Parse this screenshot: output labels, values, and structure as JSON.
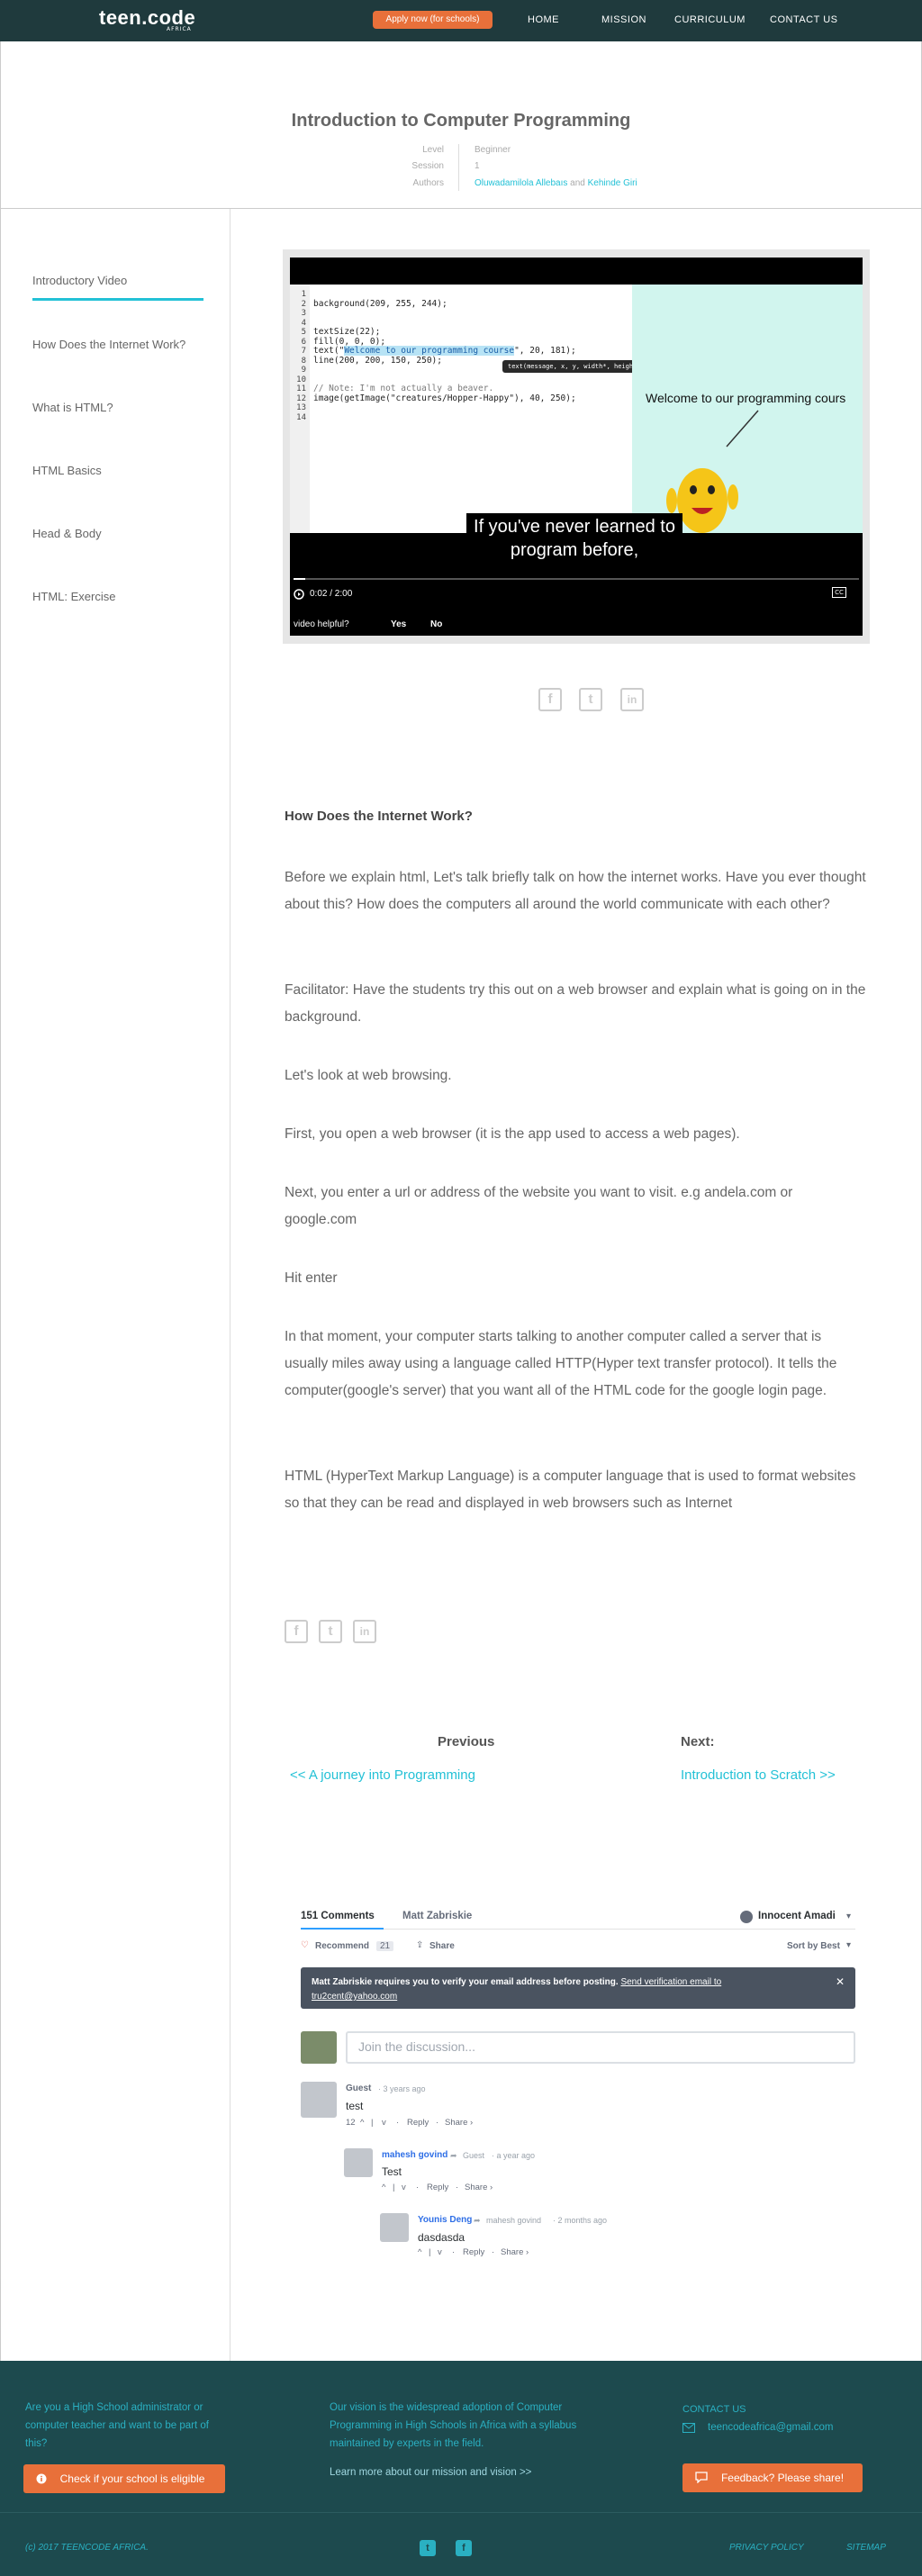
{
  "nav": {
    "logo": "teen.code",
    "logo_sub": "AFRICA",
    "apply_label": "Apply now (for schools)",
    "links": [
      "HOME",
      "MISSION",
      "CURRICULUM",
      "CONTACT US"
    ]
  },
  "header": {
    "title": "Introduction to Computer Programming",
    "level_label": "Level",
    "level_value": "Beginner",
    "session_label": "Session",
    "session_value": "1",
    "authors_label": "Authors",
    "author_1": "Oluwadamilola Allebaıs",
    "author_join": "and",
    "author_2": "Kehinde Giri"
  },
  "sidebar": {
    "items": [
      {
        "label": "Introductory Video"
      },
      {
        "label": "How Does the Internet Work?"
      },
      {
        "label": "What is HTML?"
      },
      {
        "label": "HTML Basics"
      },
      {
        "label": "Head & Body"
      },
      {
        "label": "HTML: Exercise"
      }
    ]
  },
  "video": {
    "line_numbers": "1\n2\n3\n4\n5\n6\n7\n8\n9\n10\n11\n12\n13\n14",
    "code_l2": "background(209, 255, 244);",
    "code_l5": "textSize(22);",
    "code_l6": "fill(0, 0, 0);",
    "code_l7_pre": "text(\"",
    "code_l7_hl": "Welcome to our programming course",
    "code_l7_post": "\", 20, 181);",
    "code_l8": "line(200, 200, 150, 250);",
    "code_l11": "// Note: I'm not actually a beaver.",
    "code_l12": "image(getImage(\"creatures/Hopper-Happy\"), 40, 250);",
    "tooltip": "text(message, x, y, width*, height*)",
    "canvas_text": "Welcome to our programming cours",
    "caption": "If you've never learned to program before,",
    "time": "0:02 / 2:00",
    "progress": 0.02,
    "cc": "CC",
    "helpful_label": "video helpful?",
    "yes": "Yes",
    "no": "No"
  },
  "article": {
    "heading": "How Does the Internet Work?",
    "paragraphs": [
      "Before we explain html, Let's talk briefly talk on how the internet works. Have you ever thought about this? How does the computers all around the world communicate with each other?",
      "Facilitator: Have the students try this out on a web browser and explain what is going on in the background.",
      "Let's look at web browsing.",
      "First, you open a web browser (it is the app used to access a web pages).",
      "Next, you enter a url or address of the website you want to visit. e.g andela.com or google.com",
      "Hit enter",
      "In that moment, your computer starts talking to another computer called a server that is usually miles away using a language called HTTP(Hyper text transfer protocol). It tells the computer(google's server) that you want all of the HTML code for the google login page.",
      "HTML (HyperText Markup Language) is a computer language that is used to format websites so that they can be read and displayed in web browsers such as Internet"
    ]
  },
  "pager": {
    "prev_label": "Previous",
    "prev_link": "<< A journey into Programming",
    "next_label": "Next:",
    "next_link": "Introduction to Scratch >>"
  },
  "comments": {
    "count_tab": "151 Comments",
    "site_tab": "Matt Zabriskie",
    "user": "Innocent Amadi",
    "recommend": "Recommend",
    "recommend_count": "21",
    "share": "Share",
    "sort": "Sort by Best",
    "notice_pre": "Matt Zabriskie requires you to verify your email address before posting.",
    "notice_link": "Send verification email to",
    "notice_email": "tru2cent@yahoo.com",
    "input_placeholder": "Join the discussion...",
    "items": [
      {
        "name": "Guest",
        "meta": "· 3 years ago",
        "body": "test",
        "votes": "12",
        "reply": "Reply",
        "share": "Share ›"
      },
      {
        "name": "mahesh govind",
        "reply_to": "Guest",
        "meta": "· a year ago",
        "body": "Test",
        "reply": "Reply",
        "share": "Share ›"
      },
      {
        "name": "Younis Deng",
        "reply_to": "mahesh govind",
        "meta": "· 2 months ago",
        "body": "dasdasda",
        "reply": "Reply",
        "share": "Share ›"
      }
    ]
  },
  "footer": {
    "col1": "Are you a High School administrator or computer teacher and want to be part of this?",
    "col1_btn": "Check if your school is eligible",
    "col2": "Our vision is the widespread adoption of Computer Programming in High Schools in Africa with a syllabus maintained by experts in the field.",
    "col2_link": "Learn more about our mission and vision >>",
    "contact_title": "CONTACT US",
    "email": "teencodeafrica@gmail.com",
    "feedback_btn": "Feedback? Please share!",
    "copyright": "(c) 2017 TEENCODE AFRICA.",
    "privacy": "PRIVACY POLICY",
    "sitemap": "SITEMAP"
  },
  "colors": {
    "nav_bg": "#1f3a3d",
    "accent": "#23c1d6",
    "orange": "#e8703a",
    "footer_bg": "#1d4a4e"
  }
}
